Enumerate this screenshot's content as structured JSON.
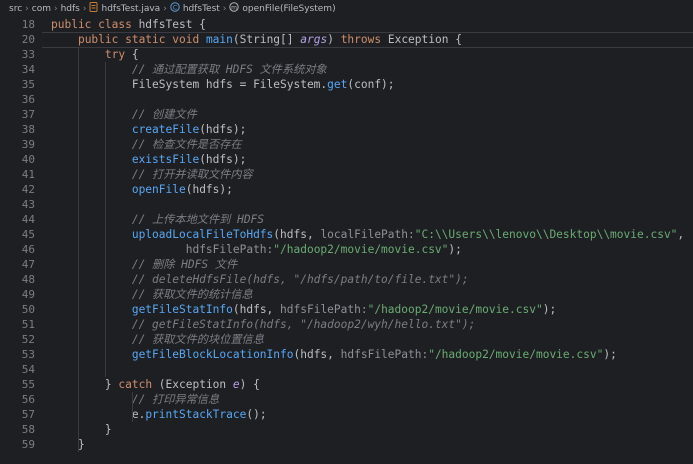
{
  "breadcrumb": {
    "items": [
      {
        "label": "src",
        "icon": "folder-icon"
      },
      {
        "label": "com",
        "icon": "package-icon"
      },
      {
        "label": "hdfs",
        "icon": "package-icon"
      },
      {
        "label": "hdfsTest.java",
        "icon": "java-file-icon"
      },
      {
        "label": "hdfsTest",
        "icon": "class-icon"
      },
      {
        "label": "openFile(FileSystem)",
        "icon": "method-icon"
      }
    ]
  },
  "colors": {
    "background": "#1e1f22",
    "keyword": "#cf8e6d",
    "comment": "#7a7e85",
    "method": "#56a8f5",
    "string": "#6aab73",
    "parameter": "#b8a0e6",
    "text": "#bcbec4"
  },
  "editor": {
    "lines": [
      {
        "num": "18",
        "tokens": [
          [
            "kw",
            "public class "
          ],
          [
            "id",
            "hdfsTest {"
          ]
        ]
      },
      {
        "num": "20",
        "tokens": [
          [
            "sp",
            "    "
          ],
          [
            "kw",
            "public static void "
          ],
          [
            "fn",
            "main"
          ],
          [
            "id",
            "(String[] "
          ],
          [
            "pm",
            "args"
          ],
          [
            "id",
            ") "
          ],
          [
            "kw",
            "throws "
          ],
          [
            "id",
            "Exception {"
          ]
        ]
      },
      {
        "num": "33",
        "tokens": [
          [
            "sp",
            "        "
          ],
          [
            "kw",
            "try "
          ],
          [
            "id",
            "{"
          ]
        ]
      },
      {
        "num": "34",
        "tokens": [
          [
            "sp",
            "            "
          ],
          [
            "cm",
            "// 通过配置获取 HDFS 文件系统对象"
          ]
        ]
      },
      {
        "num": "35",
        "tokens": [
          [
            "sp",
            "            "
          ],
          [
            "id",
            "FileSystem hdfs = FileSystem."
          ],
          [
            "fn",
            "get"
          ],
          [
            "id",
            "(conf);"
          ]
        ]
      },
      {
        "num": "36",
        "tokens": []
      },
      {
        "num": "37",
        "tokens": [
          [
            "sp",
            "            "
          ],
          [
            "cm",
            "// 创建文件"
          ]
        ]
      },
      {
        "num": "38",
        "tokens": [
          [
            "sp",
            "            "
          ],
          [
            "fn",
            "createFile"
          ],
          [
            "id",
            "(hdfs);"
          ]
        ]
      },
      {
        "num": "39",
        "tokens": [
          [
            "sp",
            "            "
          ],
          [
            "cm",
            "// 检查文件是否存在"
          ]
        ]
      },
      {
        "num": "40",
        "tokens": [
          [
            "sp",
            "            "
          ],
          [
            "fn",
            "existsFile"
          ],
          [
            "id",
            "(hdfs);"
          ]
        ]
      },
      {
        "num": "41",
        "tokens": [
          [
            "sp",
            "            "
          ],
          [
            "cm",
            "// 打开并读取文件内容"
          ]
        ]
      },
      {
        "num": "42",
        "tokens": [
          [
            "sp",
            "            "
          ],
          [
            "fn",
            "openFile"
          ],
          [
            "id",
            "(hdfs);"
          ]
        ]
      },
      {
        "num": "43",
        "tokens": []
      },
      {
        "num": "44",
        "tokens": [
          [
            "sp",
            "            "
          ],
          [
            "cm",
            "// 上传本地文件到 HDFS"
          ]
        ]
      },
      {
        "num": "45",
        "tokens": [
          [
            "sp",
            "            "
          ],
          [
            "fn",
            "uploadLocalFileToHdfs"
          ],
          [
            "id",
            "(hdfs, "
          ],
          [
            "hint",
            "localFilePath:"
          ],
          [
            "st",
            "\"C:\\\\Users\\\\lenovo\\\\Desktop\\\\movie.csv\""
          ],
          [
            "id",
            ","
          ]
        ]
      },
      {
        "num": "46",
        "tokens": [
          [
            "sp",
            "                    "
          ],
          [
            "hint",
            "hdfsFilePath:"
          ],
          [
            "st",
            "\"/hadoop2/movie/movie.csv\""
          ],
          [
            "id",
            ");"
          ]
        ]
      },
      {
        "num": "47",
        "tokens": [
          [
            "sp",
            "            "
          ],
          [
            "cm",
            "// 删除 HDFS 文件"
          ]
        ]
      },
      {
        "num": "48",
        "tokens": [
          [
            "sp",
            "            "
          ],
          [
            "cm",
            "// deleteHdfsFile(hdfs, \"/hdfs/path/to/file.txt\");"
          ]
        ]
      },
      {
        "num": "49",
        "tokens": [
          [
            "sp",
            "            "
          ],
          [
            "cm",
            "// 获取文件的统计信息"
          ]
        ]
      },
      {
        "num": "50",
        "tokens": [
          [
            "sp",
            "            "
          ],
          [
            "fn",
            "getFileStatInfo"
          ],
          [
            "id",
            "(hdfs, "
          ],
          [
            "hint",
            "hdfsFilePath:"
          ],
          [
            "st",
            "\"/hadoop2/movie/movie.csv\""
          ],
          [
            "id",
            ");"
          ]
        ]
      },
      {
        "num": "51",
        "tokens": [
          [
            "sp",
            "            "
          ],
          [
            "cm",
            "// getFileStatInfo(hdfs, \"/hadoop2/wyh/hello.txt\");"
          ]
        ]
      },
      {
        "num": "52",
        "tokens": [
          [
            "sp",
            "            "
          ],
          [
            "cm",
            "// 获取文件的块位置信息"
          ]
        ]
      },
      {
        "num": "53",
        "tokens": [
          [
            "sp",
            "            "
          ],
          [
            "fn",
            "getFileBlockLocationInfo"
          ],
          [
            "id",
            "(hdfs, "
          ],
          [
            "hint",
            "hdfsFilePath:"
          ],
          [
            "st",
            "\"/hadoop2/movie/movie.csv\""
          ],
          [
            "id",
            ");"
          ]
        ]
      },
      {
        "num": "54",
        "tokens": []
      },
      {
        "num": "55",
        "tokens": [
          [
            "sp",
            "        "
          ],
          [
            "id",
            "} "
          ],
          [
            "kw",
            "catch "
          ],
          [
            "id",
            "(Exception "
          ],
          [
            "pm",
            "e"
          ],
          [
            "id",
            ") {"
          ]
        ]
      },
      {
        "num": "56",
        "tokens": [
          [
            "sp",
            "            "
          ],
          [
            "cm",
            "// 打印异常信息"
          ]
        ]
      },
      {
        "num": "57",
        "tokens": [
          [
            "sp",
            "            "
          ],
          [
            "id",
            "e."
          ],
          [
            "fn",
            "printStackTrace"
          ],
          [
            "id",
            "();"
          ]
        ]
      },
      {
        "num": "58",
        "tokens": [
          [
            "sp",
            "        "
          ],
          [
            "id",
            "}"
          ]
        ]
      },
      {
        "num": "59",
        "tokens": [
          [
            "sp",
            "    "
          ],
          [
            "id",
            "}"
          ]
        ]
      }
    ]
  }
}
